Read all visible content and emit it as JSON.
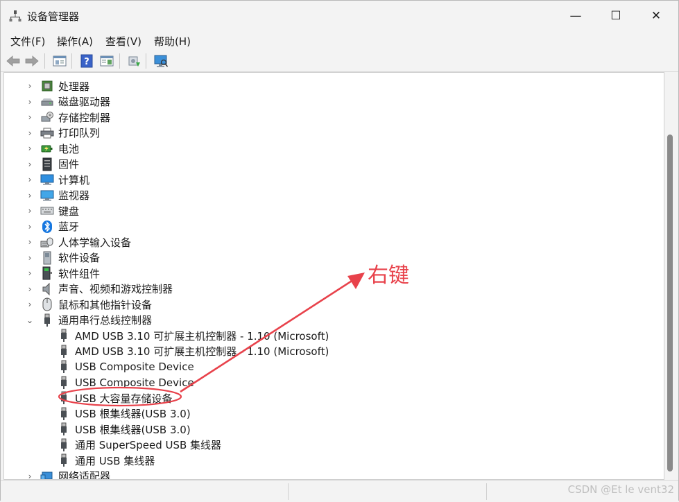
{
  "window": {
    "title": "设备管理器",
    "controls": {
      "minimize": "—",
      "maximize": "☐",
      "close": "✕"
    }
  },
  "menu": [
    "文件(F)",
    "操作(A)",
    "查看(V)",
    "帮助(H)"
  ],
  "toolbar": {
    "buttons": [
      "back-arrow-icon",
      "forward-arrow-icon",
      "properties-sheet-icon",
      "help-icon",
      "view-pane-icon",
      "update-driver-icon",
      "scan-hardware-monitor-icon"
    ]
  },
  "tree": {
    "categories": [
      {
        "label": "处理器",
        "icon": "processor-chip-icon",
        "expanded": false
      },
      {
        "label": "磁盘驱动器",
        "icon": "disk-drive-icon",
        "expanded": false
      },
      {
        "label": "存储控制器",
        "icon": "storage-controller-icon",
        "expanded": false
      },
      {
        "label": "打印队列",
        "icon": "printer-icon",
        "expanded": false
      },
      {
        "label": "电池",
        "icon": "battery-icon",
        "expanded": false
      },
      {
        "label": "固件",
        "icon": "firmware-icon",
        "expanded": false
      },
      {
        "label": "计算机",
        "icon": "computer-monitor-icon",
        "expanded": false
      },
      {
        "label": "监视器",
        "icon": "display-monitor-icon",
        "expanded": false
      },
      {
        "label": "键盘",
        "icon": "keyboard-icon",
        "expanded": false
      },
      {
        "label": "蓝牙",
        "icon": "bluetooth-icon",
        "expanded": false
      },
      {
        "label": "人体学输入设备",
        "icon": "hid-icon",
        "expanded": false
      },
      {
        "label": "软件设备",
        "icon": "software-device-icon",
        "expanded": false
      },
      {
        "label": "软件组件",
        "icon": "software-component-icon",
        "expanded": false
      },
      {
        "label": "声音、视频和游戏控制器",
        "icon": "speaker-icon",
        "expanded": false
      },
      {
        "label": "鼠标和其他指针设备",
        "icon": "mouse-icon",
        "expanded": false
      },
      {
        "label": "通用串行总线控制器",
        "icon": "usb-plug-icon",
        "expanded": true
      }
    ],
    "usb_children": [
      "AMD USB 3.10 可扩展主机控制器 - 1.10 (Microsoft)",
      "AMD USB 3.10 可扩展主机控制器 - 1.10 (Microsoft)",
      "USB Composite Device",
      "USB Composite Device",
      "USB 大容量存储设备",
      "USB 根集线器(USB 3.0)",
      "USB 根集线器(USB 3.0)",
      "通用 SuperSpeed USB 集线器",
      "通用 USB 集线器"
    ],
    "after": [
      {
        "label": "网络适配器",
        "icon": "network-adapter-icon",
        "expanded": false
      }
    ]
  },
  "annotation": {
    "label": "右键",
    "color": "#e8424b",
    "highlighted_item": "USB 大容量存储设备"
  },
  "status": {
    "watermark": "CSDN @Et le vent32"
  }
}
